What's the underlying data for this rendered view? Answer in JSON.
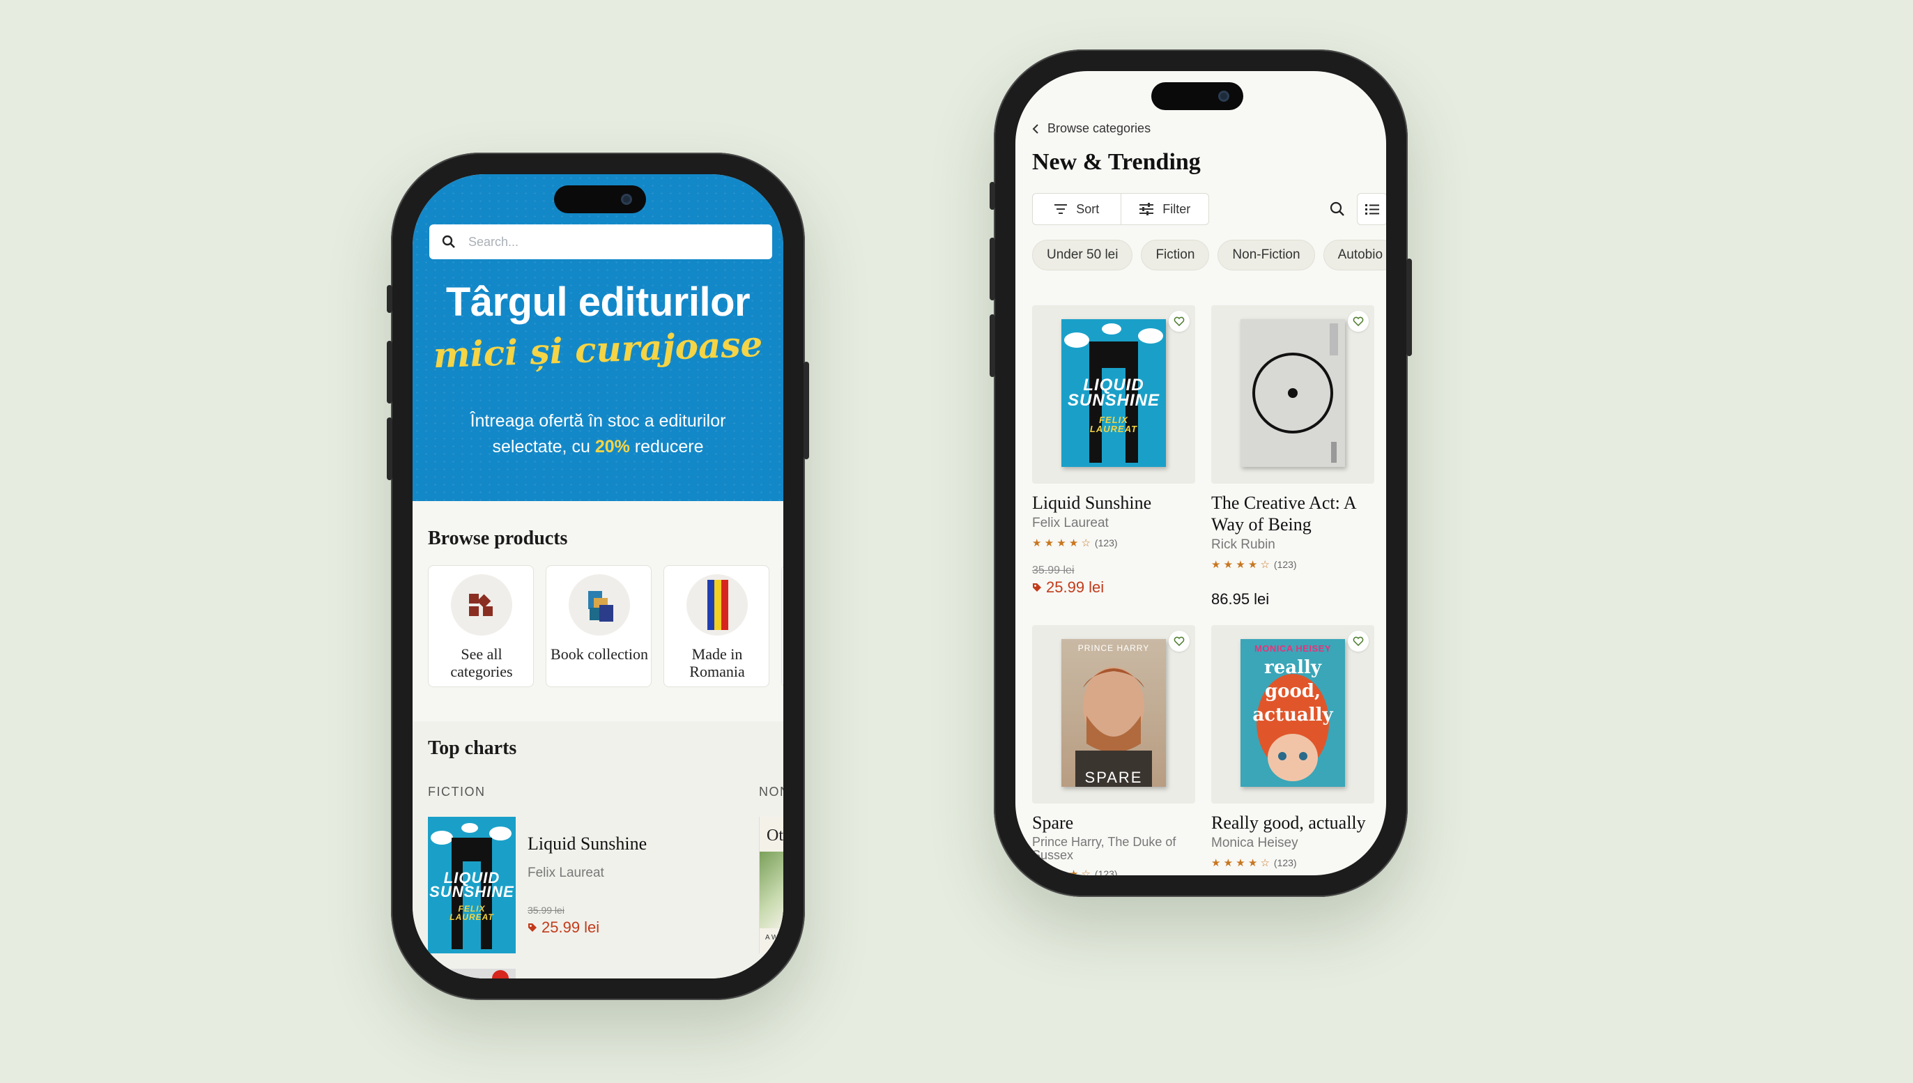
{
  "colors": {
    "background": "#e6ece0",
    "hero": "#1388c8",
    "accent_yellow": "#f5d445",
    "sale_red": "#c23b1a",
    "star": "#c8761e"
  },
  "phone1": {
    "search": {
      "placeholder": "Search..."
    },
    "hero": {
      "title": "Târgul editurilor",
      "subtitle": "mici și curajoase",
      "body_prefix": "Întreaga ofertă în stoc a editurilor selectate, cu ",
      "body_highlight": "20%",
      "body_suffix": " reducere"
    },
    "browse": {
      "title": "Browse products",
      "items": [
        {
          "label": "See all categories",
          "icon": "grid-icon"
        },
        {
          "label": "Book collection",
          "icon": "books-icon"
        },
        {
          "label": "Made in Romania",
          "icon": "romania-flag-icon"
        }
      ]
    },
    "charts": {
      "title": "Top charts",
      "col1_label": "FICTION",
      "col2_label": "NON",
      "item": {
        "title": "Liquid Sunshine",
        "author": "Felix Laureat",
        "old_price": "35.99 lei",
        "price": "25.99 lei",
        "cover_line1": "LIQUID",
        "cover_line2": "SUNSHINE",
        "cover_author1": "FELIX",
        "cover_author2": "LAUREAT"
      },
      "peek_text": "Ot",
      "peek_sub": "A Wo"
    }
  },
  "phone2": {
    "back_label": "Browse categories",
    "title": "New & Trending",
    "sort_label": "Sort",
    "filter_label": "Filter",
    "chips": [
      "Under 50 lei",
      "Fiction",
      "Non-Fiction",
      "Autobio"
    ],
    "products": [
      {
        "title": "Liquid Sunshine",
        "author": "Felix Laureat",
        "rating": 4,
        "reviews": "(123)",
        "old_price": "35.99 lei",
        "price": "25.99 lei",
        "on_sale": true
      },
      {
        "title": "The Creative Act: A Way of Being",
        "author": "Rick Rubin",
        "rating": 4,
        "reviews": "(123)",
        "price": "86.95 lei",
        "on_sale": false
      },
      {
        "title": "Spare",
        "author": "Prince Harry, The Duke of Sussex",
        "rating": 4,
        "reviews": "(123)",
        "cover_top": "PRINCE HARRY",
        "cover_bottom": "SPARE"
      },
      {
        "title": "Really good, actually",
        "author": "Monica Heisey",
        "rating": 4,
        "reviews": "(123)",
        "cover_top": "MONICA HEISEY",
        "cover_line1": "really",
        "cover_line2": "good,",
        "cover_line3": "actually"
      }
    ]
  }
}
